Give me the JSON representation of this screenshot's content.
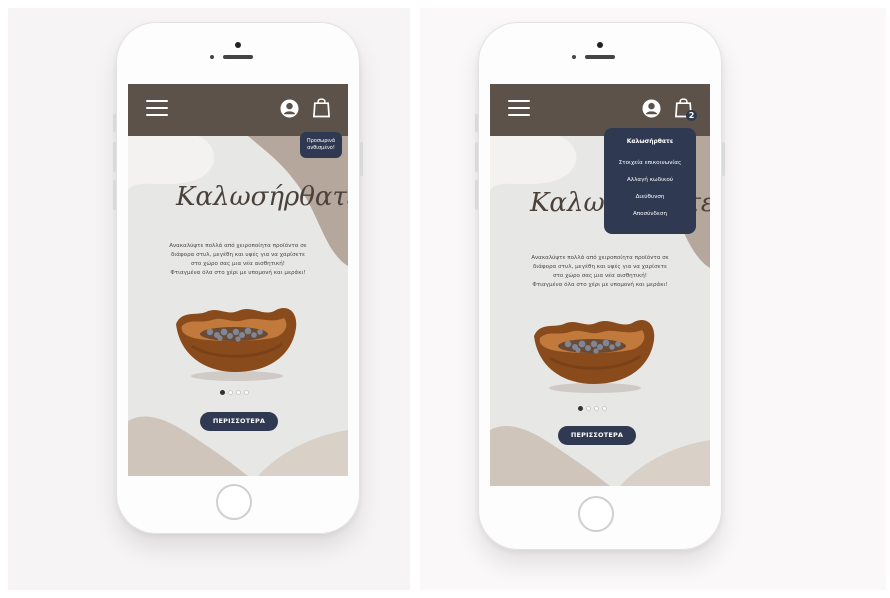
{
  "header": {
    "menu_icon": "hamburger-icon",
    "user_icon": "user-circle-icon",
    "cart_icon": "shopping-bag-icon",
    "bg_color": "#5c5249"
  },
  "hero": {
    "title": "Καλωσήρθατε",
    "description": [
      "Ανακαλύψτε πολλά από χειροποίητα προϊόντα σε",
      "διάφορα στυλ, μεγέθη και υφές για να χαρίσετε",
      "στο χώρο σας μια νέα αισθητική!",
      "Φτιαγμένα όλα στο χέρι με υπομονή και μεράκι!"
    ],
    "image_alt": "wooden bowl with stones",
    "carousel": {
      "count": 4,
      "active": 0
    },
    "more_button": "ΠΕΡΙΣΣΟΤΕΡΑ"
  },
  "left_screen": {
    "tooltip": [
      "Προσωρινά",
      "ανθισμένο!"
    ]
  },
  "right_screen": {
    "cart_count": "2",
    "account_menu": {
      "title": "Καλωσήρθατε",
      "items": [
        "Στοιχεία επικοινωνίας",
        "Αλλαγή κωδικού",
        "Διεύθυνση",
        "Αποσύνδεση"
      ]
    }
  },
  "colors": {
    "accent": "#2f3a52",
    "screen_bg": "#e7e7e6",
    "shape_tan": "#b5a79c"
  }
}
